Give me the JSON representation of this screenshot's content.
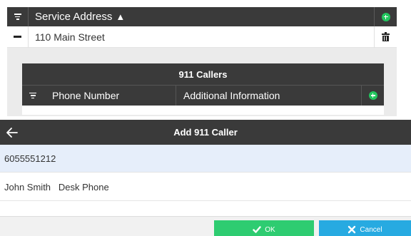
{
  "main_grid": {
    "header": {
      "title": "Service Address",
      "sort_indicator": "▲",
      "filter_icon": "filter-icon",
      "add_icon": "add-circle-icon"
    },
    "rows": [
      {
        "address": "110 Main Street",
        "collapse_icon": "minus-icon",
        "delete_icon": "trash-icon"
      }
    ]
  },
  "sub_grid": {
    "title": "911 Callers",
    "columns": [
      "Phone Number",
      "Additional Information"
    ],
    "filter_icon": "filter-icon",
    "add_icon": "add-circle-icon",
    "rows": []
  },
  "dialog": {
    "title": "Add 911 Caller",
    "back_icon": "arrow-left-icon",
    "phone_value": "6055551212",
    "info_value": "John Smith   Desk Phone",
    "ok_label": "OK",
    "cancel_label": "Cancel"
  },
  "colors": {
    "header_bg": "#3a3a3a",
    "add_green": "#22c55e",
    "ok_green": "#2ecc71",
    "cancel_blue": "#27aae1",
    "selected_field_bg": "#e6eefa"
  }
}
